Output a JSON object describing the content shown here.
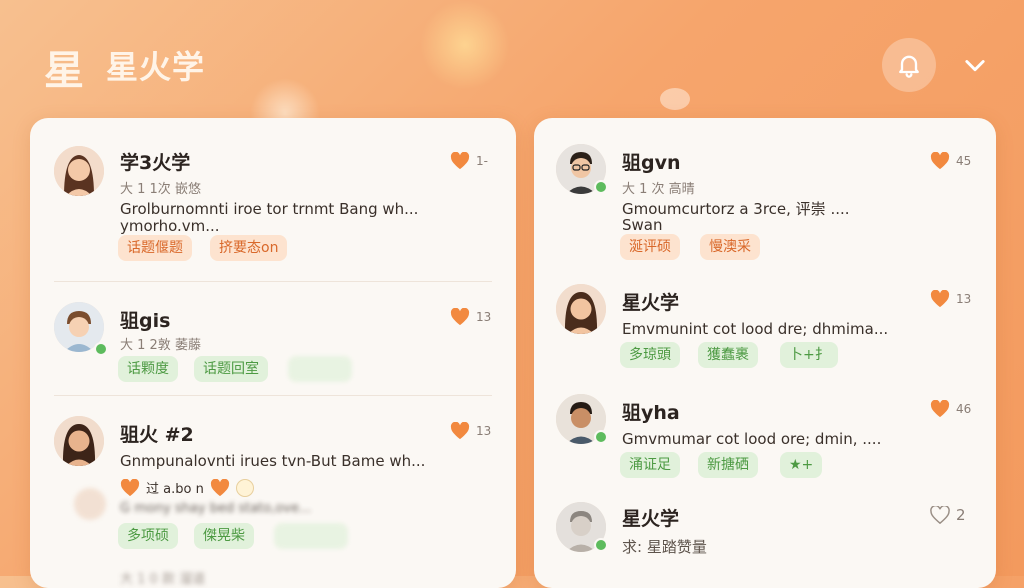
{
  "header": {
    "logo_char": "星",
    "title": "星火学"
  },
  "left_feed": {
    "posts": [
      {
        "name": "学3火学",
        "meta": "大 1 1次  嵌悠",
        "content_line1": "Grolburnomnti iroe tor trnmt Bang wh...",
        "content_line2": "ymorho.vm...",
        "likes": "1-",
        "tags": [
          "话题偃题",
          "挤要态on"
        ]
      },
      {
        "name": "驵gis",
        "meta": "大 1 2敦 萎藤",
        "likes": "13",
        "tags": [
          "话颗度",
          "话题回室"
        ]
      },
      {
        "name": "驵火 #2",
        "content_line1": "Gnmpunalovnti irues tvn-But Bame wh...",
        "reaction_label": "过 a.bo n",
        "likes": "13",
        "blurred_line": "G mony shay bed stato,ove...",
        "tags": [
          "多项硕",
          "傑晃柴"
        ]
      },
      {
        "meta": "大 1 0 款 溜道"
      }
    ]
  },
  "right_feed": {
    "posts": [
      {
        "name": "驵gvn",
        "meta": "大 1 次  高晴",
        "content_line1": "Gmoumcurtorz a 3rce, 评崇 ....",
        "content_line2": "Swan",
        "likes": "45",
        "tags": [
          "涎评硕",
          "慢澳采"
        ]
      },
      {
        "name": "星火学",
        "content_line1": "Emvmunint cot lood dre; dhmima...",
        "likes": "13",
        "tags": [
          "多琼頭",
          "獲蠢裹",
          "卜+扌"
        ]
      },
      {
        "name": "驵yha",
        "content_line1": "Gmvmumar cot lood ore; dmin, ....",
        "likes": "46",
        "tags": [
          "涌证足",
          "新搪硒",
          "★+"
        ]
      },
      {
        "name": "星火学",
        "meta": "求: 星踏赞量",
        "likes": "2"
      }
    ]
  },
  "colors": {
    "accent_orange": "#f39a5e",
    "heart": "#f2893f",
    "online": "#5dbb5d"
  },
  "icons": [
    "bell-icon",
    "chevron-down-icon",
    "heart-icon"
  ]
}
